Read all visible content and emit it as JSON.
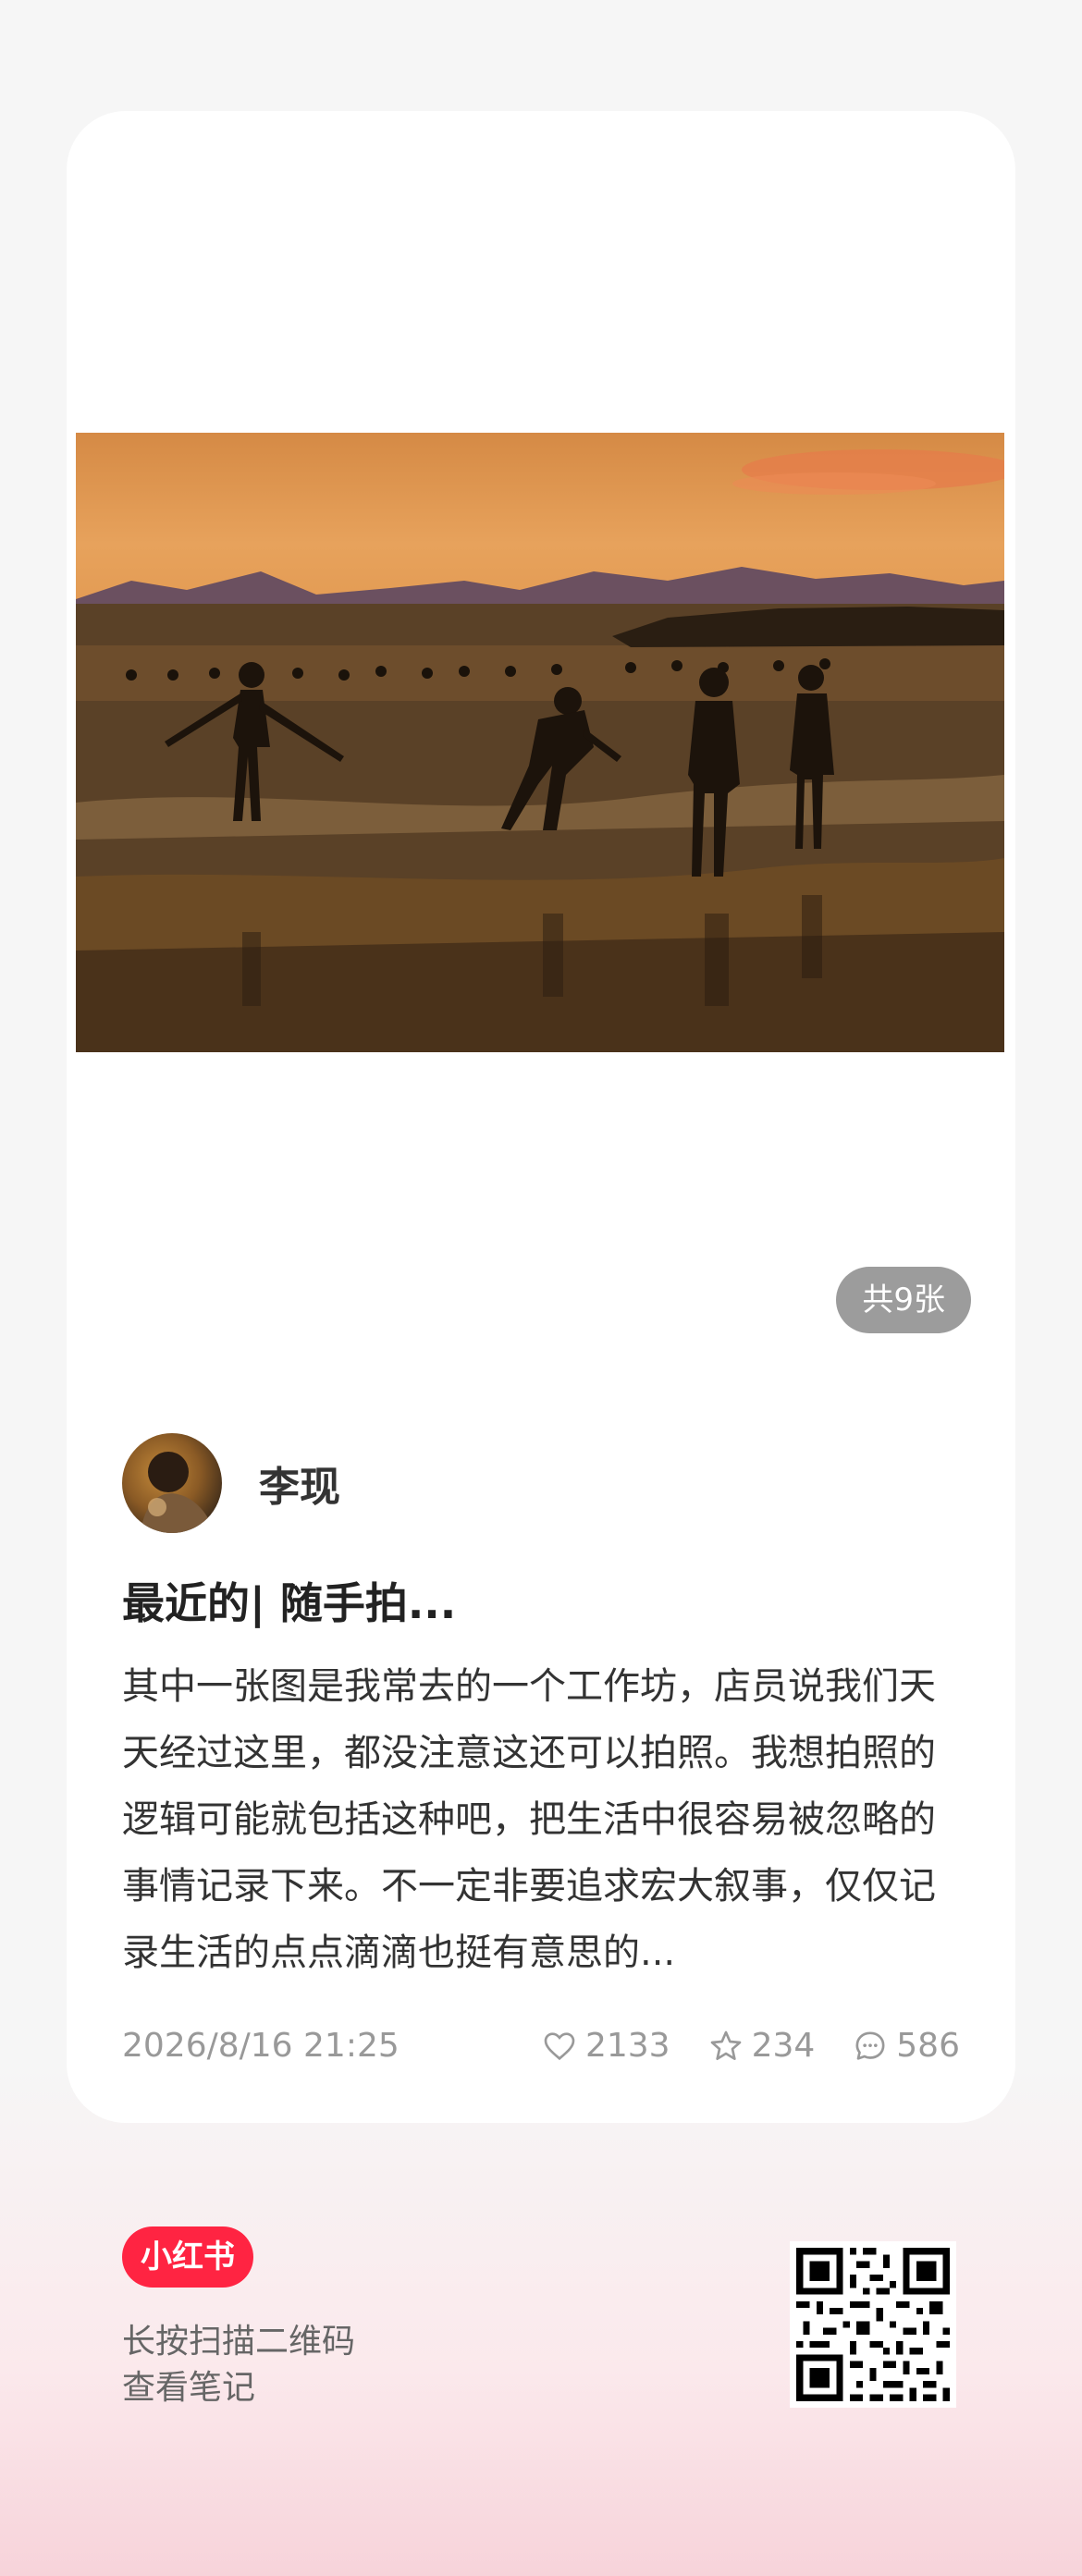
{
  "post": {
    "image_count": "共9张",
    "author": "李现",
    "title": "最近的| 随手拍...",
    "description": "其中一张图是我常去的一个工作坊，店员说我们天天经过这里，都没注意这还可以拍照。我想拍照的逻辑可能就包括这种吧，把生活中很容易被忽略的事情记录下来。不一定非要追求宏大叙事，仅仅记录生活的点点滴滴也挺有意思的...",
    "date": "2026/8/16 21:25",
    "likes": "2133",
    "favorites": "234",
    "comments": "586"
  },
  "footer": {
    "brand": "小红书",
    "hint_line1": "长按扫描二维码",
    "hint_line2": "查看笔记"
  },
  "icons": {
    "like": "heart-icon",
    "favorite": "star-icon",
    "comment": "comment-icon"
  },
  "colors": {
    "brand": "#ff2442",
    "card": "#ffffff",
    "meta_text": "#999999"
  }
}
